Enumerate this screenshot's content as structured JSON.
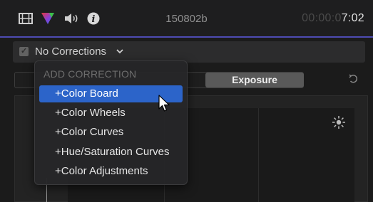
{
  "header": {
    "clip_name": "150802b",
    "timecode_dim": "00:00:0",
    "timecode_bright": "7:02",
    "icons": [
      "film-icon",
      "color-icon",
      "audio-icon",
      "info-icon"
    ]
  },
  "corrections": {
    "label": "No Corrections",
    "enabled": true
  },
  "tabs": {
    "active_label": "Exposure"
  },
  "menu": {
    "header": "ADD CORRECTION",
    "items": [
      {
        "label": "+Color Board",
        "selected": true
      },
      {
        "label": "+Color Wheels",
        "selected": false
      },
      {
        "label": "+Color Curves",
        "selected": false
      },
      {
        "label": "+Hue/Saturation Curves",
        "selected": false
      },
      {
        "label": "+Color Adjustments",
        "selected": false
      }
    ]
  },
  "colors": {
    "accent": "#4e4bb3",
    "selection": "#2c64c9"
  }
}
